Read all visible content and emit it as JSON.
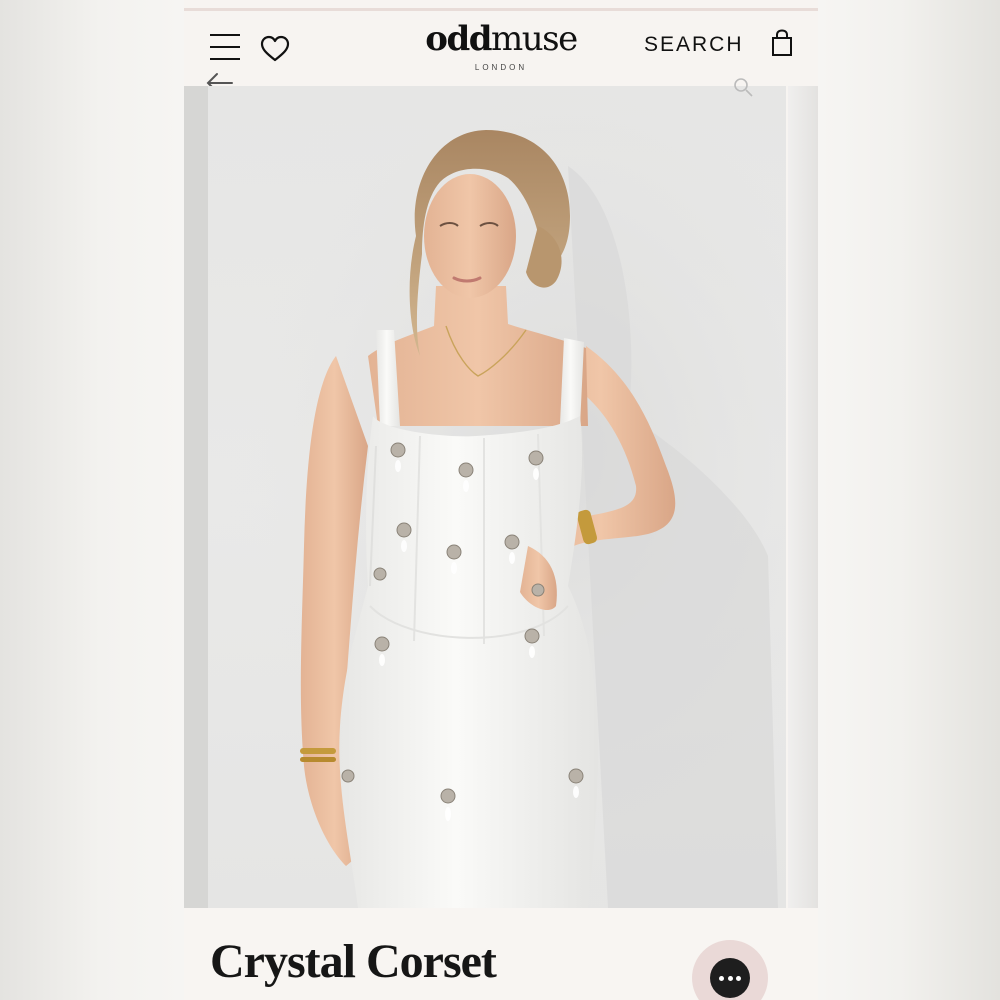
{
  "header": {
    "logo_primary_bold": "odd",
    "logo_primary_light": "muse",
    "logo_secondary": "LONDON",
    "search_label": "SEARCH"
  },
  "product": {
    "title": "Crystal Corset"
  },
  "icons": [
    "hamburger-menu-icon",
    "heart-icon",
    "shopping-bag-icon",
    "back-arrow-icon",
    "zoom-icon",
    "chat-icon"
  ],
  "colors": {
    "page_bg": "#f7f4f1",
    "text": "#111111",
    "chat_ring": "#ead9d7",
    "chat_core": "#1e1e1e",
    "dress": "#f4f4f2"
  }
}
